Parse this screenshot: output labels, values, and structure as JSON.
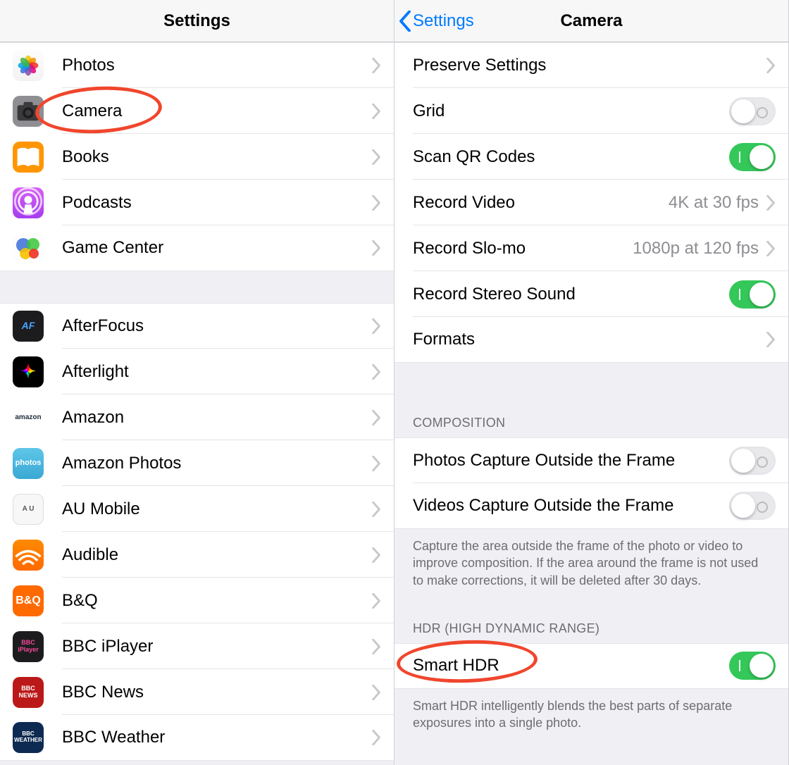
{
  "left": {
    "title": "Settings",
    "groups": [
      {
        "items": [
          {
            "label": "Photos",
            "icon": "photos"
          },
          {
            "label": "Camera",
            "icon": "camera",
            "annot": true
          },
          {
            "label": "Books",
            "icon": "books"
          },
          {
            "label": "Podcasts",
            "icon": "podcasts"
          },
          {
            "label": "Game Center",
            "icon": "gamecenter"
          }
        ]
      },
      {
        "items": [
          {
            "label": "AfterFocus",
            "icon": "afterfocus"
          },
          {
            "label": "Afterlight",
            "icon": "afterlight"
          },
          {
            "label": "Amazon",
            "icon": "amazon"
          },
          {
            "label": "Amazon Photos",
            "icon": "amazonphotos"
          },
          {
            "label": "AU Mobile",
            "icon": "au"
          },
          {
            "label": "Audible",
            "icon": "audible"
          },
          {
            "label": "B&Q",
            "icon": "bq"
          },
          {
            "label": "BBC iPlayer",
            "icon": "bbciplayer"
          },
          {
            "label": "BBC News",
            "icon": "bbcnews"
          },
          {
            "label": "BBC Weather",
            "icon": "bbcweather"
          }
        ]
      }
    ]
  },
  "right": {
    "back": "Settings",
    "title": "Camera",
    "sections": [
      {
        "rows": [
          {
            "label": "Preserve Settings",
            "type": "drill"
          },
          {
            "label": "Grid",
            "type": "switch",
            "on": false
          },
          {
            "label": "Scan QR Codes",
            "type": "switch",
            "on": true
          },
          {
            "label": "Record Video",
            "type": "drill",
            "detail": "4K at 30 fps"
          },
          {
            "label": "Record Slo-mo",
            "type": "drill",
            "detail": "1080p at 120 fps"
          },
          {
            "label": "Record Stereo Sound",
            "type": "switch",
            "on": true
          },
          {
            "label": "Formats",
            "type": "drill"
          }
        ]
      },
      {
        "header": "COMPOSITION",
        "rows": [
          {
            "label": "Photos Capture Outside the Frame",
            "type": "switch",
            "on": false
          },
          {
            "label": "Videos Capture Outside the Frame",
            "type": "switch",
            "on": false
          }
        ],
        "footer": "Capture the area outside the frame of the photo or video to improve composition. If the area around the frame is not used to make corrections, it will be deleted after 30 days."
      },
      {
        "header": "HDR (HIGH DYNAMIC RANGE)",
        "rows": [
          {
            "label": "Smart HDR",
            "type": "switch",
            "on": true,
            "annot": true
          }
        ],
        "footer": "Smart HDR intelligently blends the best parts of separate exposures into a single photo."
      }
    ]
  },
  "icons": {
    "afterfocus": "AF",
    "amazon": "amazon",
    "amazonphotos": "photos",
    "au": "A  U",
    "bq": "B&Q",
    "bbciplayer": "BBC\niPlayer",
    "bbcnews": "BBC\nNEWS",
    "bbcweather": "BBC\nWEATHER"
  }
}
